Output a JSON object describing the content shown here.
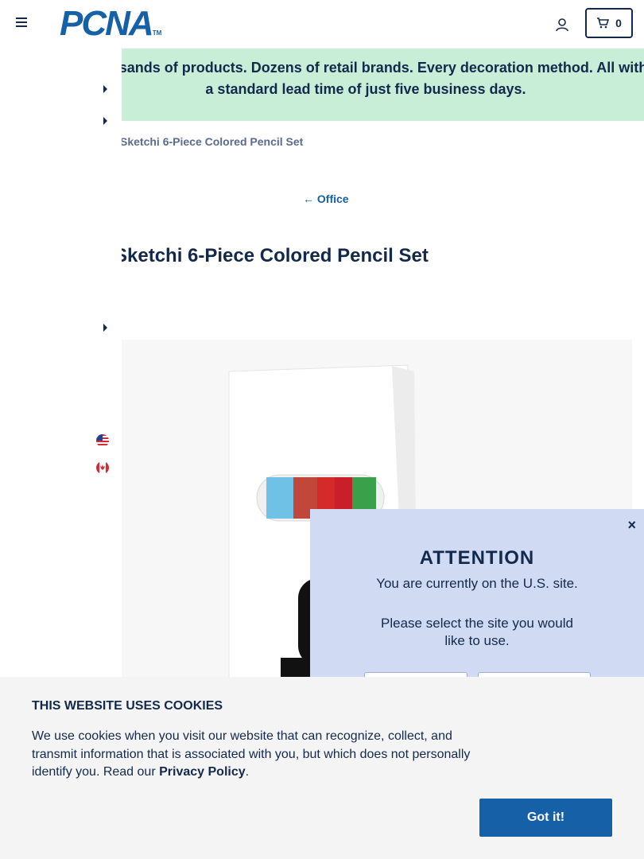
{
  "header": {
    "logo_text": "PCNA",
    "logo_tm": "TM",
    "cart_count": "0",
    "icons": [
      "menu-icon",
      "account-icon",
      "cart-icon"
    ]
  },
  "banner": {
    "text": "Thousands of products. Dozens of retail brands. Every decoration method. All with a standard lead time of just five business days."
  },
  "breadcrumb": {
    "current": "Sketchi 6-Piece Colored Pencil Set"
  },
  "back_link": {
    "label": "Office"
  },
  "product": {
    "title": "Sketchi 6-Piece Colored Pencil Set"
  },
  "feedback_tab": {
    "label": "?"
  },
  "attention_modal": {
    "close_label": "×",
    "title": "ATTENTION",
    "message": "You are currently on the U.S. site.",
    "prompt": "Please select the site you would like to use.",
    "buttons": [
      "",
      ""
    ]
  },
  "cookie_banner": {
    "title": "THIS WEBSITE USES COOKIES",
    "text": "We use cookies when you visit our website that can recognize, collect, and transmit information that is associated with you, but which does not personally identify you. Read our",
    "link_label": "Privacy Policy",
    "text_end": ".",
    "accept_label": "Got it!"
  },
  "colors": {
    "brand_blue": "#1560a6",
    "navy": "#13294b",
    "banner_green": "#c9eed8",
    "modal_blue": "#d0dbf3"
  }
}
